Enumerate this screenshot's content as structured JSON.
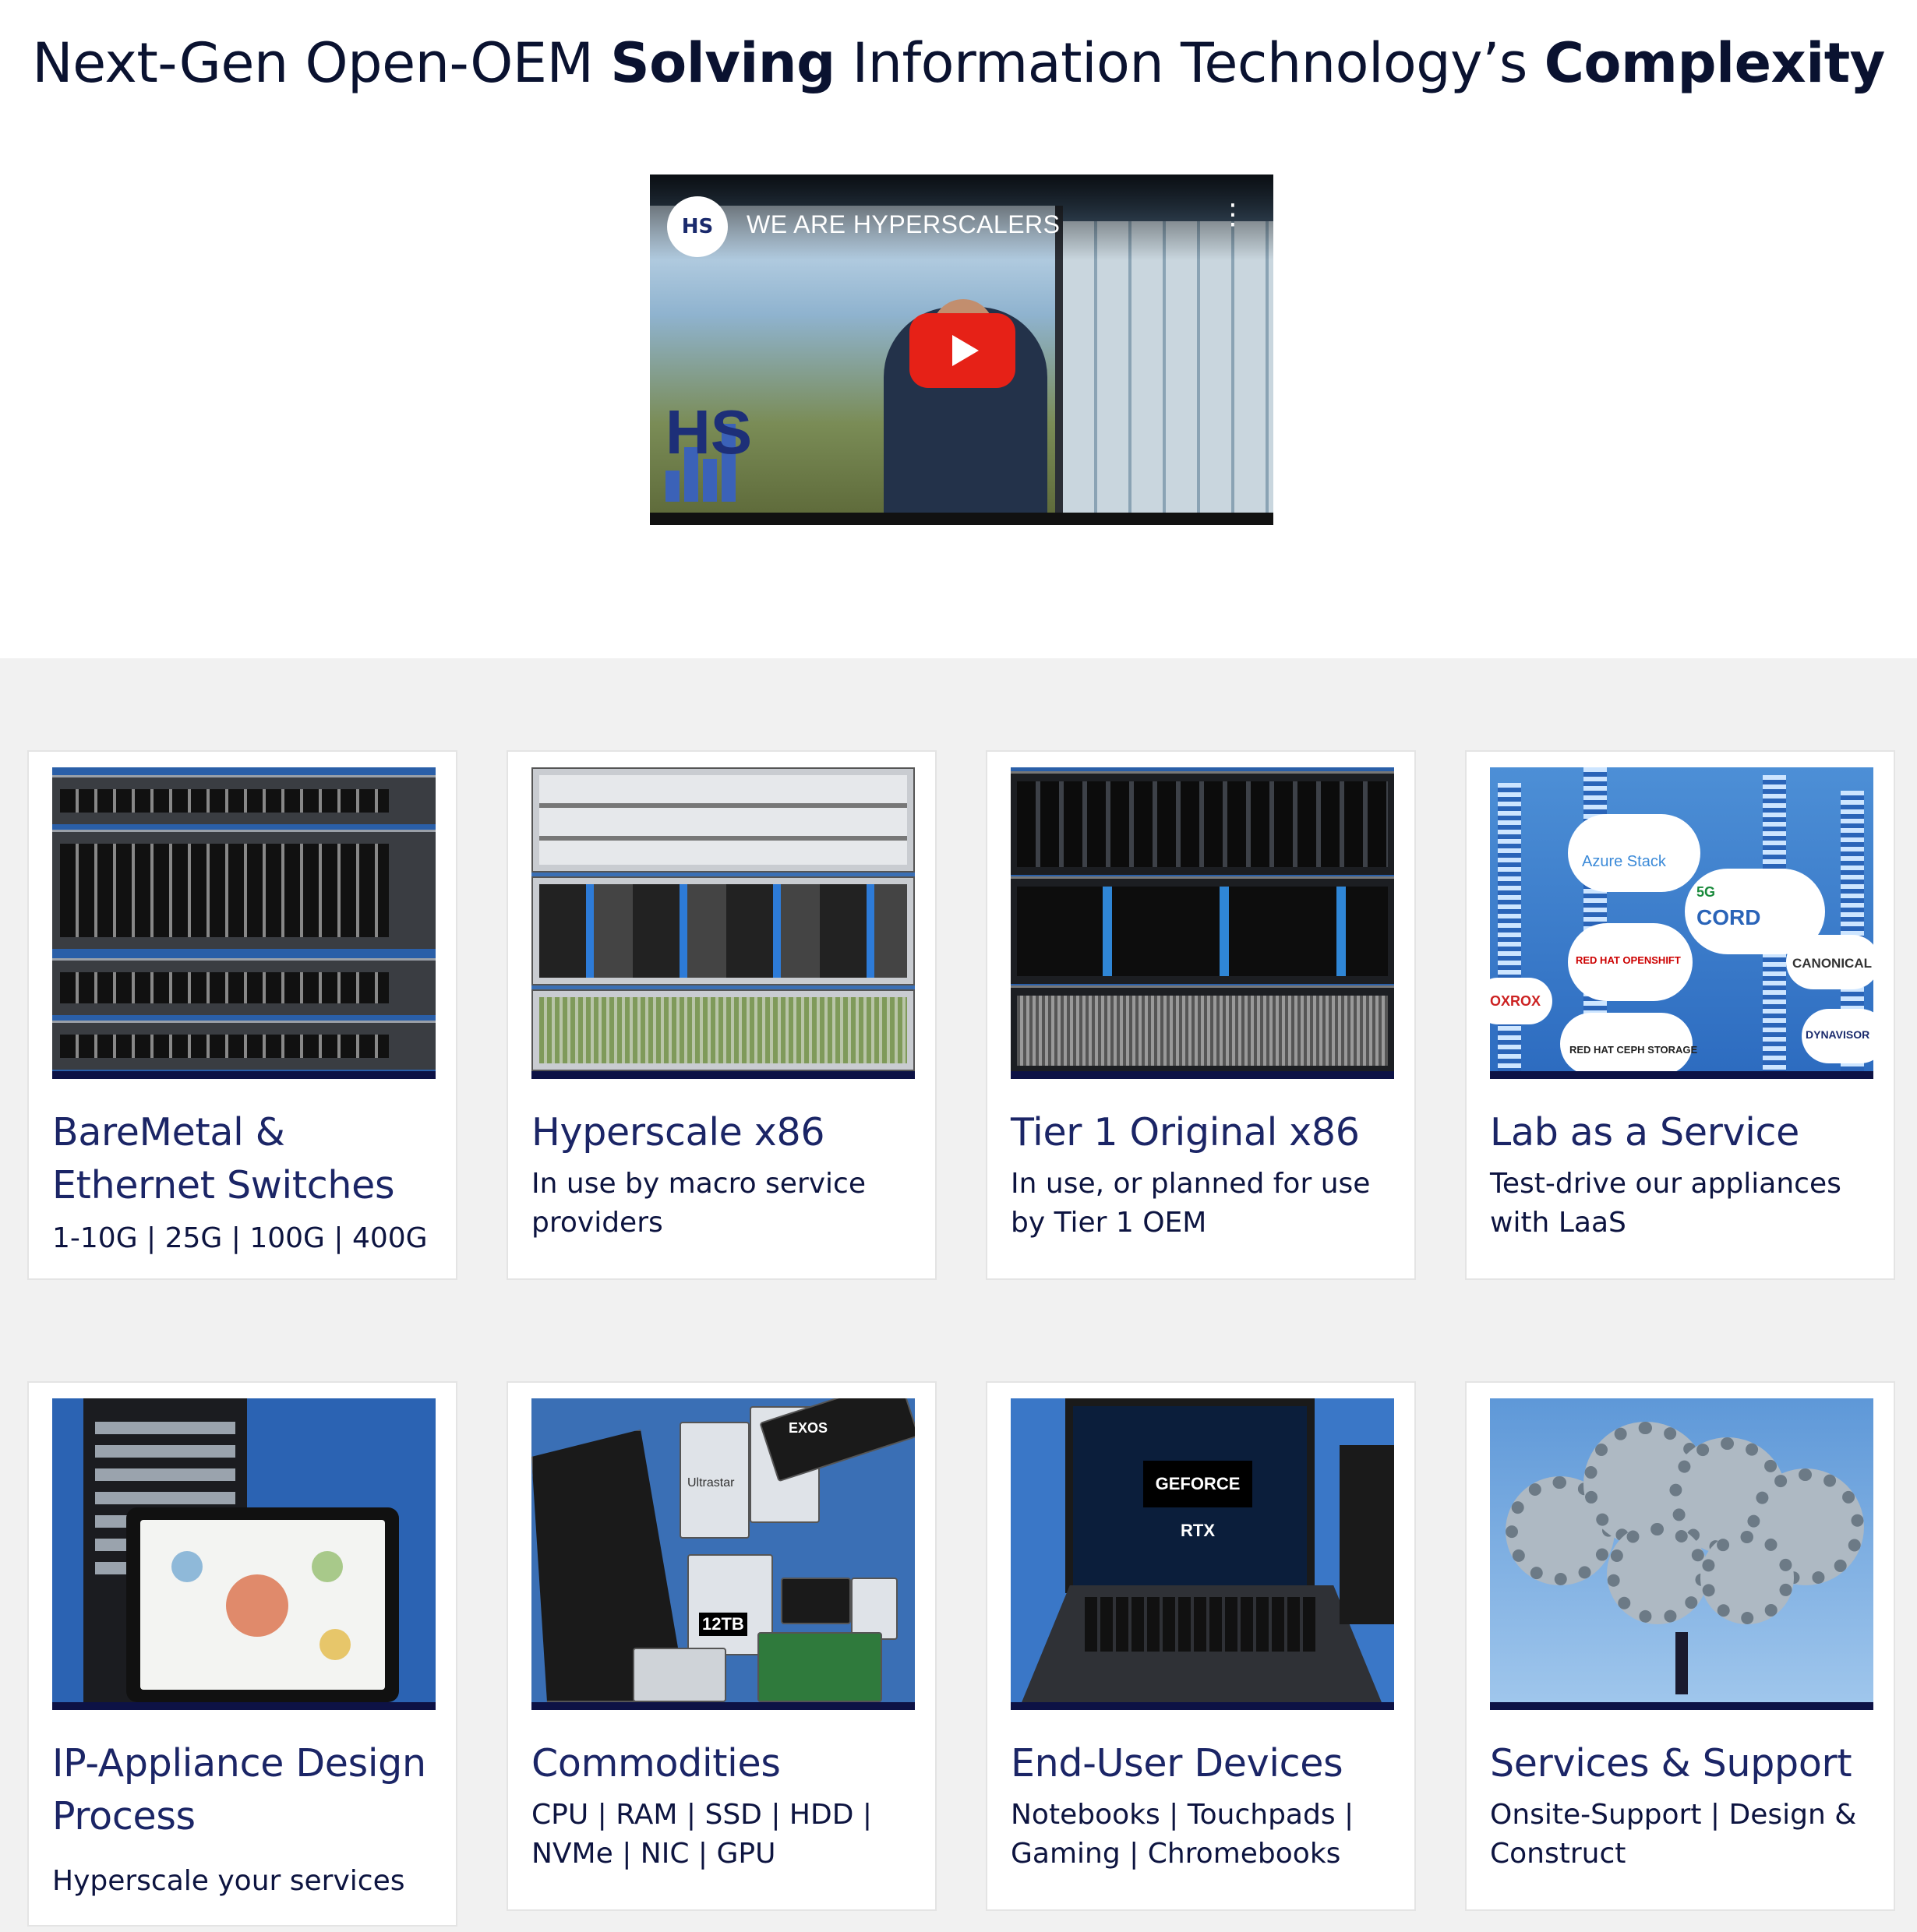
{
  "headline": {
    "part1": "Next-Gen Open-OEM ",
    "bold1": "Solving",
    "part2": " Information Technology’s ",
    "bold2": "Complexity"
  },
  "video": {
    "title": "WE ARE HYPERSCALERS",
    "channel_logo": "HS",
    "watermark": "HS",
    "play_icon": "play-icon",
    "menu_icon": "kebab-menu-icon"
  },
  "colors": {
    "heading": "#0a1230",
    "card_title": "#1b2566",
    "accent_bar": "#0d1245",
    "section_bg": "#f1f1f1",
    "play_red": "#e62117"
  },
  "cards": [
    {
      "title": "BareMetal & Ethernet Switches",
      "subtitle": "1-10G | 25G | 100G | 400G",
      "image": "network-switches-image"
    },
    {
      "title": "Hyperscale x86",
      "subtitle": "In use by macro service providers",
      "image": "hyperscale-servers-image"
    },
    {
      "title": "Tier 1 Original x86",
      "subtitle": "In use, or planned for use by Tier 1 OEM",
      "image": "tier1-servers-image"
    },
    {
      "title": "Lab as a Service",
      "subtitle": "Test-drive our appliances with LaaS",
      "image": "cloud-platforms-image",
      "image_labels": [
        "Azure Stack",
        "CORD",
        "5G",
        "RED HAT OPENSHIFT",
        "CANONICAL",
        "RED HAT CEPH STORAGE",
        "DYNAVISOR",
        "OXROX"
      ]
    },
    {
      "title": "IP-Appliance Design Process",
      "subtitle": "Hyperscale your services",
      "image": "design-tablet-image"
    },
    {
      "title": "Commodities",
      "subtitle": "CPU | RAM | SSD | HDD | NVMe | NIC | GPU",
      "image": "hardware-components-image",
      "image_labels": [
        "EXOS",
        "Ultrastar",
        "12TB"
      ]
    },
    {
      "title": "End-User Devices",
      "subtitle": "Notebooks | Touchpads | Gaming | Chromebooks",
      "image": "gaming-laptop-image",
      "image_labels": [
        "GEFORCE RTX"
      ]
    },
    {
      "title": "Services & Support",
      "subtitle": "Onsite-Support | Design & Construct",
      "image": "gears-cloud-image"
    }
  ]
}
